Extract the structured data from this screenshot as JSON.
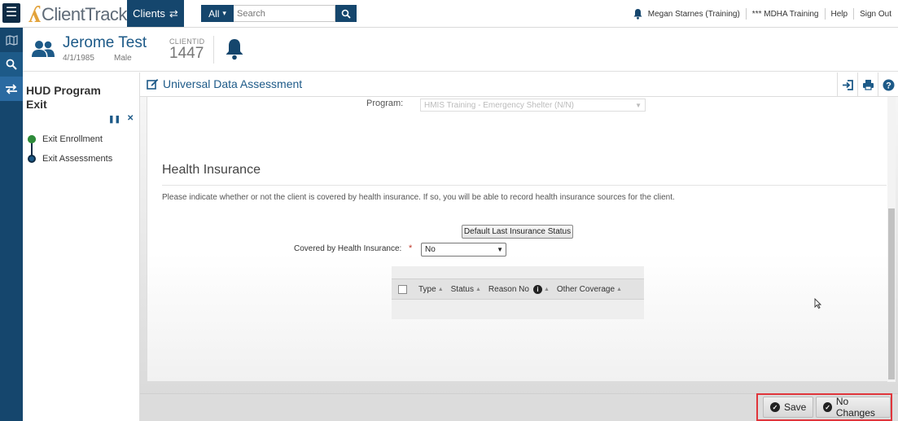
{
  "topbar": {
    "menu_icon": "hamburger-icon",
    "logo_text": "ClientTrack",
    "clients_label": "Clients",
    "search_scope": "All",
    "search_placeholder": "Search",
    "user_name": "Megan Starnes (Training)",
    "environment": "*** MDHA Training",
    "help_label": "Help",
    "signout_label": "Sign Out"
  },
  "client": {
    "name": "Jerome Test",
    "dob": "4/1/1985",
    "sex": "Male",
    "clientid_label": "CLIENTID",
    "clientid": "1447"
  },
  "workflow": {
    "title": "HUD Program Exit",
    "steps": [
      {
        "label": "Exit Enrollment",
        "status": "complete"
      },
      {
        "label": "Exit Assessments",
        "status": "current"
      }
    ]
  },
  "main": {
    "title": "Universal Data Assessment",
    "program_label": "Program:",
    "program_value": "HMIS Training - Emergency Shelter (N/N)",
    "section_title": "Health Insurance",
    "section_desc": "Please indicate whether or not the client is covered by health insurance. If so, you will be able to record health insurance sources for the client.",
    "default_button": "Default Last Insurance Status",
    "covered_label": "Covered by Health Insurance:",
    "covered_value": "No",
    "grid_columns": [
      "Type",
      "Status",
      "Reason No",
      "Other Coverage"
    ]
  },
  "footer": {
    "save_label": "Save",
    "no_changes_label": "No Changes"
  },
  "colors": {
    "navy": "#15466d",
    "accent_blue": "#1d5a88",
    "highlight_red": "#e0353b"
  }
}
